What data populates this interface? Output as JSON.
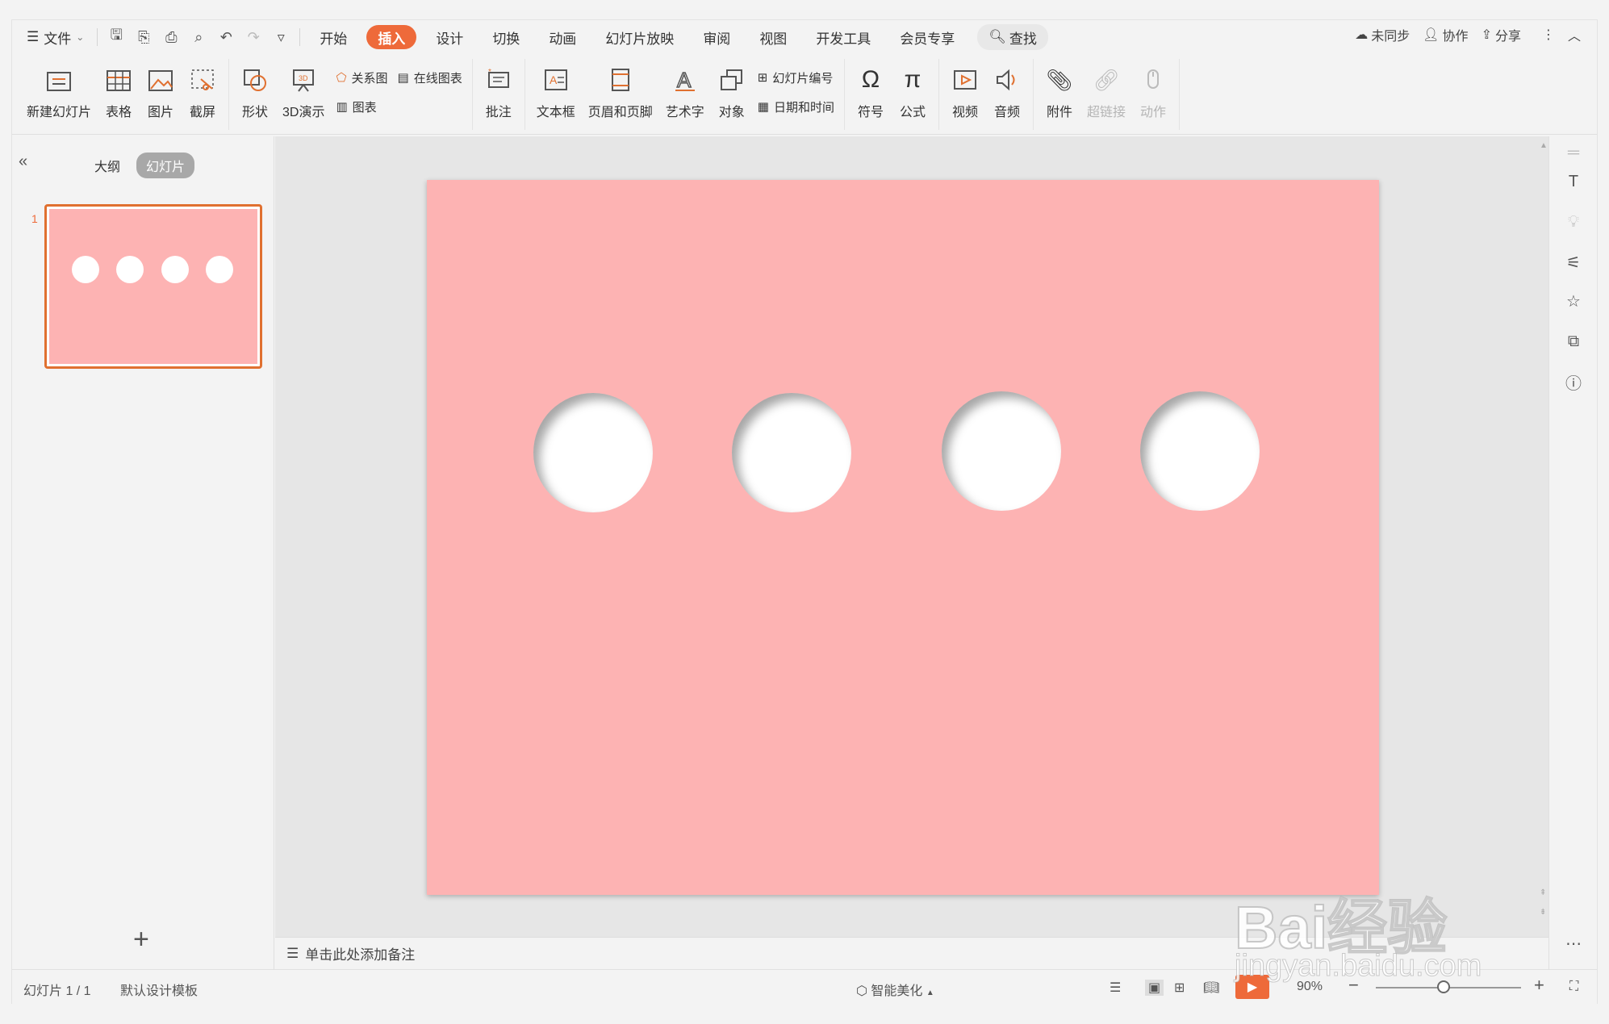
{
  "menubar": {
    "file_label": "文件",
    "tabs": [
      "开始",
      "插入",
      "设计",
      "切换",
      "动画",
      "幻灯片放映",
      "审阅",
      "视图",
      "开发工具",
      "会员专享"
    ],
    "active_tab": "插入",
    "search_label": "查找",
    "right": {
      "sync": "未同步",
      "collab": "协作",
      "share": "分享"
    }
  },
  "ribbon": {
    "new_slide": "新建幻灯片",
    "table": "表格",
    "picture": "图片",
    "screenshot": "截屏",
    "shape": "形状",
    "demo3d": "3D演示",
    "smartart": "关系图",
    "online_chart": "在线图表",
    "chart": "图表",
    "comment": "批注",
    "textbox": "文本框",
    "header_footer": "页眉和页脚",
    "wordart": "艺术字",
    "object": "对象",
    "slide_number": "幻灯片编号",
    "date_time": "日期和时间",
    "symbol": "符号",
    "formula": "公式",
    "video": "视频",
    "audio": "音频",
    "attachment": "附件",
    "hyperlink": "超链接",
    "action": "动作"
  },
  "leftpanel": {
    "tab_outline": "大纲",
    "tab_slides": "幻灯片",
    "slide_number": "1"
  },
  "notes": {
    "placeholder": "单击此处添加备注"
  },
  "statusbar": {
    "slide_info": "幻灯片 1 / 1",
    "template": "默认设计模板",
    "beautify": "智能美化",
    "zoom": "90%"
  },
  "watermark": {
    "brand": "Bai经验",
    "url": "jingyan.baidu.com"
  },
  "colors": {
    "accent": "#ee6a3a",
    "slide_bg": "#fdb3b3",
    "hole": "#ffffff"
  }
}
